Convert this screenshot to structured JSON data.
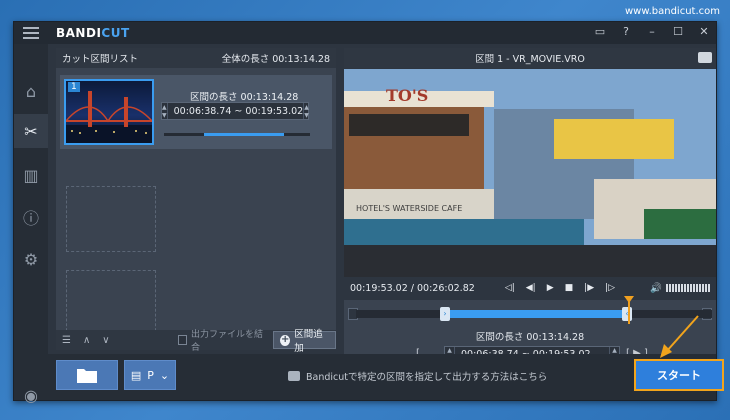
{
  "watermark": "www.bandicut.com",
  "app": {
    "logo_main": "BANDI",
    "logo_accent": "CUT"
  },
  "window_controls": [
    "folder-icon",
    "help-icon",
    "minimize-icon",
    "maximize-icon",
    "close-icon"
  ],
  "sidebar": {
    "items": [
      {
        "icon": "home-icon",
        "active": false
      },
      {
        "icon": "cut-icon",
        "active": true
      },
      {
        "icon": "film-icon",
        "active": false
      },
      {
        "icon": "info-icon",
        "active": false
      },
      {
        "icon": "settings-icon",
        "active": false
      }
    ]
  },
  "cut_list": {
    "title": "カット区間リスト",
    "total_length": "全体の長さ 00:13:14.28",
    "clip": {
      "number": "1",
      "length": "区間の長さ 00:13:14.28",
      "range": "00:06:38.74 ~ 00:19:53.02",
      "progress": 0.56
    },
    "merge_label": "出力ファイルを結合",
    "add_button": "区間追加"
  },
  "preview": {
    "title": "区間 1 - VR_MOVIE.VRO",
    "time": "00:19:53.02 / 00:26:02.82"
  },
  "timeline": {
    "length_label": "区間の長さ 00:13:14.28",
    "range": "00:06:38.74 ~ 00:19:53.02",
    "bracket_left": "[",
    "bracket_right": "[ ▶ ]"
  },
  "bottom": {
    "hint": "Bandicutで特定の区間を指定して出力する方法はこちら",
    "start": "スタート",
    "format_label": "P"
  }
}
